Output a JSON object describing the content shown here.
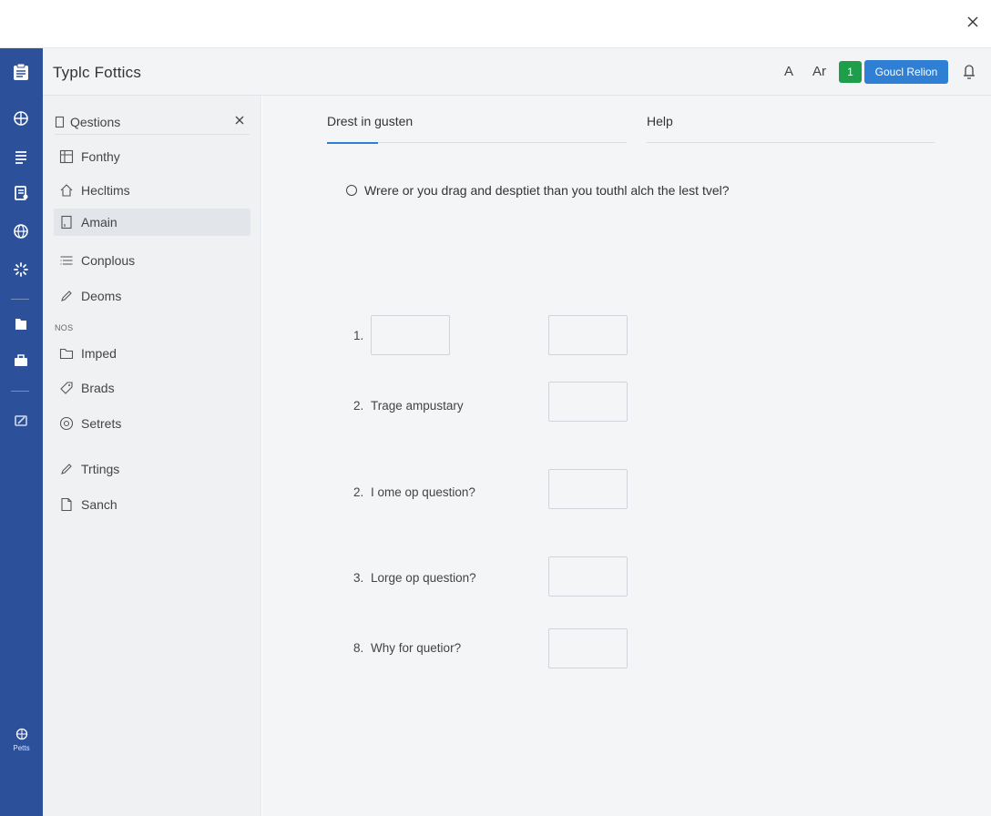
{
  "app": {
    "title": "Typlc Fottics"
  },
  "header": {
    "font_small": "A",
    "font_large": "Ar",
    "badge": "1",
    "primary_button": "Goucl Relion"
  },
  "sidebar": {
    "head": "Qestions",
    "items": [
      {
        "label": "Fonthy",
        "icon": "grid-icon"
      },
      {
        "label": "Hecltims",
        "icon": "home-icon"
      },
      {
        "label": "Amain",
        "icon": "doc-icon",
        "active": true
      },
      {
        "label": "Conplous",
        "icon": "list-icon"
      },
      {
        "label": "Deoms",
        "icon": "pencil-icon"
      }
    ],
    "section_label": "NOS",
    "items2": [
      {
        "label": "Imped",
        "icon": "folder-icon"
      },
      {
        "label": "Brads",
        "icon": "tag-icon"
      },
      {
        "label": "Setrets",
        "icon": "circle-icon"
      },
      {
        "label": "Trtings",
        "icon": "pencil-icon"
      },
      {
        "label": "Sanch",
        "icon": "page-icon"
      }
    ]
  },
  "rail": {
    "footer_label": "Petts"
  },
  "tabs": [
    {
      "label": "Drest in gusten",
      "active": true
    },
    {
      "label": "Help",
      "active": false
    }
  ],
  "main": {
    "prompt": "Wrere or you drag and desptiet than you touthl alch the lest tvel?",
    "questions": [
      {
        "num": "1.",
        "text": ""
      },
      {
        "num": "2.",
        "text": "Trage ampustary"
      },
      {
        "num": "2.",
        "text": "I ome op question?"
      },
      {
        "num": "3.",
        "text": "Lorge op question?"
      },
      {
        "num": "8.",
        "text": "Why for quetior?"
      }
    ]
  },
  "colors": {
    "rail": "#2d509a",
    "accent": "#2f7fd4",
    "badge": "#1e9e4a"
  }
}
